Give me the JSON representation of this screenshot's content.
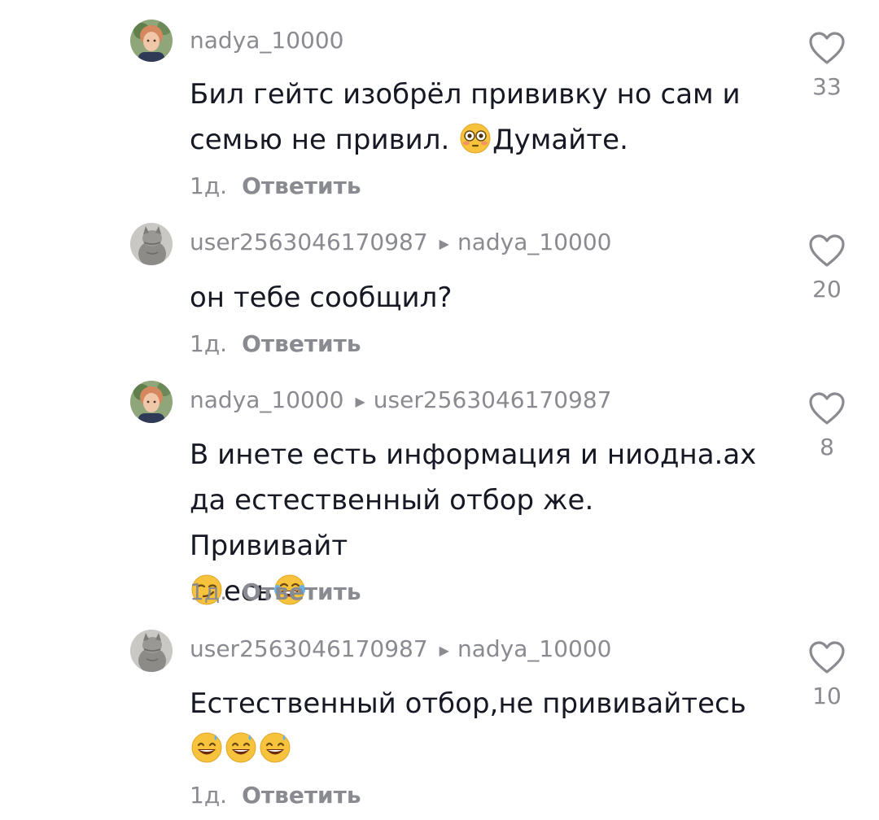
{
  "comments": [
    {
      "author": "nadya_10000",
      "reply_to": "",
      "text_parts": [
        "Бил гейтс изобрёл прививку но сам и семью не привил. ",
        "Думайте."
      ],
      "emoji_1": "flushed-face-emoji",
      "time": "1д.",
      "reply_label": "Ответить",
      "likes": "33",
      "avatar": "woman-avatar"
    },
    {
      "author": "user2563046170987",
      "reply_to": "nadya_10000",
      "text": "он тебе сообщил?",
      "time": "1д.",
      "reply_label": "Ответить",
      "likes": "20",
      "avatar": "cat-avatar"
    },
    {
      "author": "nadya_10000",
      "reply_to": "user2563046170987",
      "text_parts": [
        "В инете есть информация и ниодна.ах да естественный отбор же. Прививайт",
        "есь"
      ],
      "emojis": [
        "smirking-face-emoji",
        "tears-of-joy-emoji"
      ],
      "time": "1д.",
      "reply_label": "Ответить",
      "likes": "8",
      "avatar": "woman-avatar"
    },
    {
      "author": "user2563046170987",
      "reply_to": "nadya_10000",
      "text": "Естественный отбор,не прививайтесь",
      "emojis": [
        "grinning-sweat-emoji",
        "grinning-sweat-emoji",
        "grinning-sweat-emoji"
      ],
      "time": "1д.",
      "reply_label": "Ответить",
      "likes": "10",
      "avatar": "cat-avatar"
    }
  ],
  "colors": {
    "text": "#161823",
    "muted": "#8a8b91",
    "emoji_yellow": "#f7c33c"
  }
}
